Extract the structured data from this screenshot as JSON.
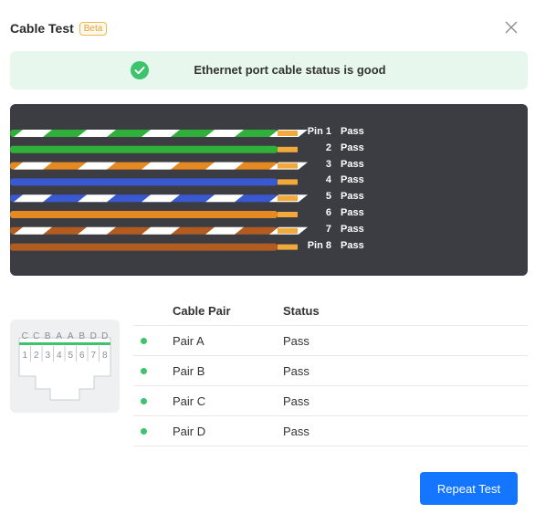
{
  "header": {
    "title": "Cable Test",
    "badge": "Beta"
  },
  "banner": {
    "message": "Ethernet port cable status is good",
    "color": "#3cc36b"
  },
  "pins": [
    {
      "label": "Pin 1",
      "result": "Pass"
    },
    {
      "label": "2",
      "result": "Pass"
    },
    {
      "label": "3",
      "result": "Pass"
    },
    {
      "label": "4",
      "result": "Pass"
    },
    {
      "label": "5",
      "result": "Pass"
    },
    {
      "label": "6",
      "result": "Pass"
    },
    {
      "label": "7",
      "result": "Pass"
    },
    {
      "label": "Pin 8",
      "result": "Pass"
    }
  ],
  "wire_colors": [
    "#2fb03a",
    "#2fb03a",
    "#e58a22",
    "#3a59d1",
    "#3a59d1",
    "#e58a22",
    "#b35c22",
    "#b35c22"
  ],
  "wire_striped": [
    true,
    false,
    true,
    false,
    true,
    false,
    true,
    false
  ],
  "port": {
    "pair_letters": [
      "C",
      "C",
      "B",
      "A",
      "A",
      "B",
      "D",
      "D"
    ],
    "pin_numbers": [
      "1",
      "2",
      "3",
      "4",
      "5",
      "6",
      "7",
      "8"
    ]
  },
  "table": {
    "headers": {
      "pair": "Cable Pair",
      "status": "Status"
    },
    "rows": [
      {
        "pair": "Pair A",
        "status": "Pass"
      },
      {
        "pair": "Pair B",
        "status": "Pass"
      },
      {
        "pair": "Pair C",
        "status": "Pass"
      },
      {
        "pair": "Pair D",
        "status": "Pass"
      }
    ]
  },
  "actions": {
    "repeat_label": "Repeat Test"
  }
}
